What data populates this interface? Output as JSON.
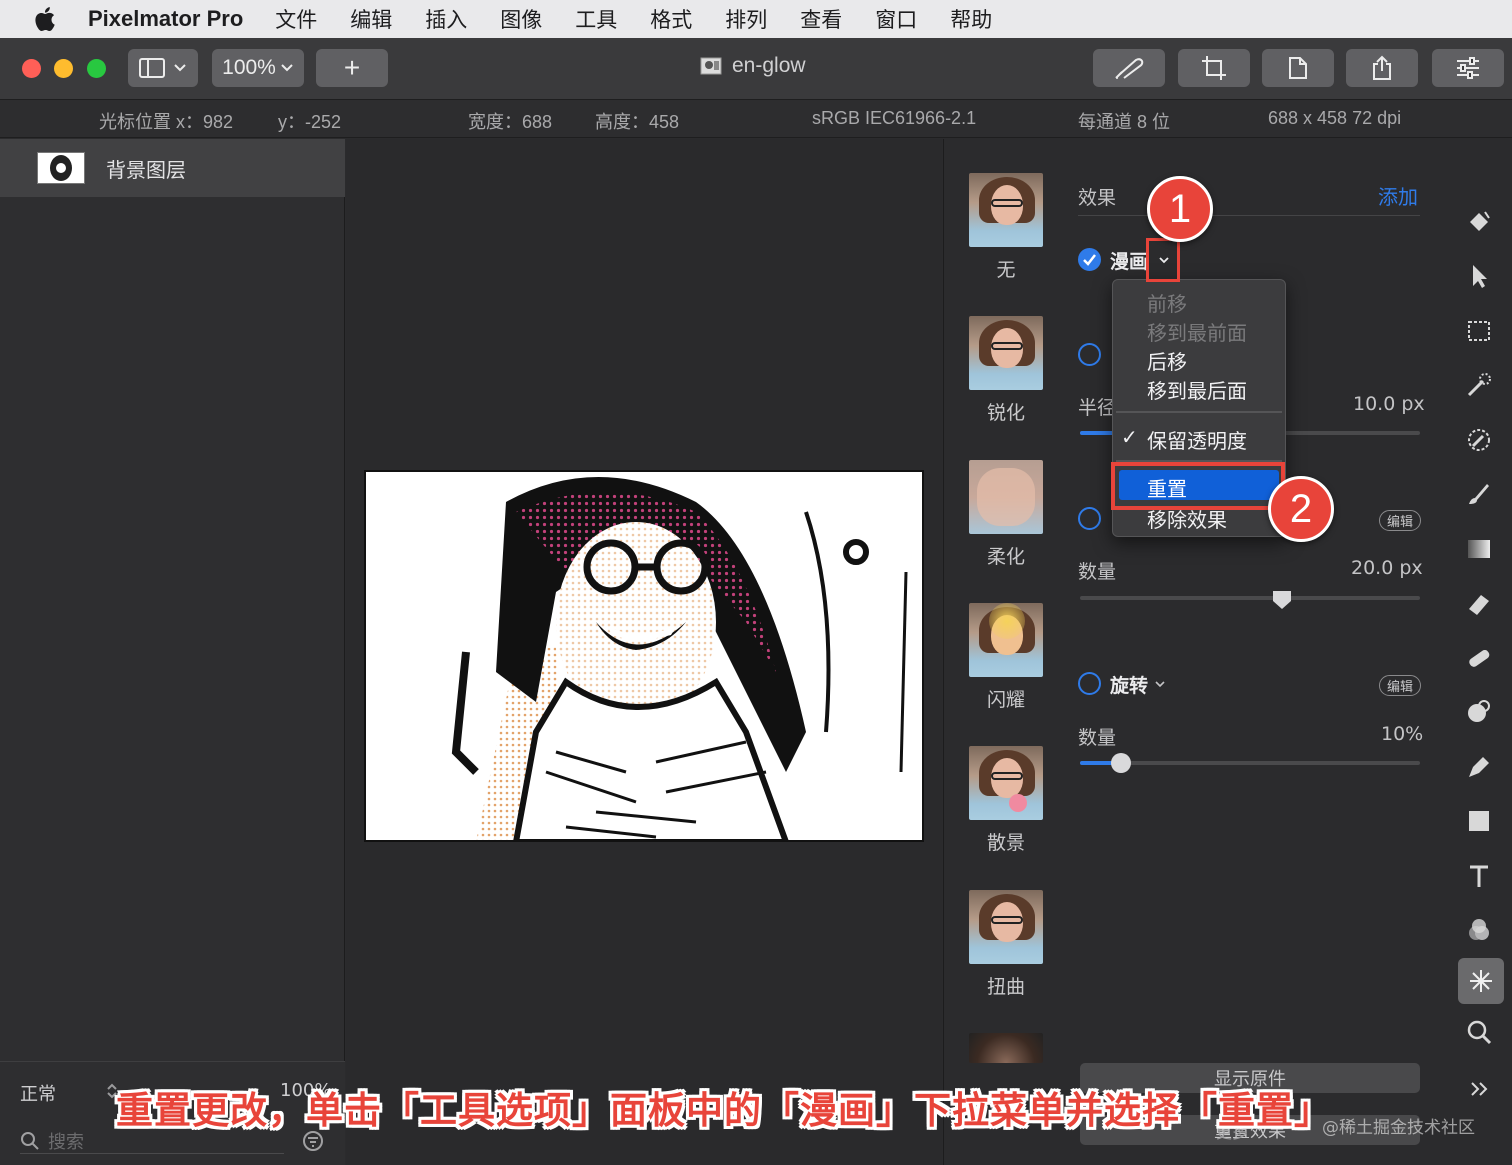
{
  "menubar": {
    "app_name": "Pixelmator Pro",
    "items": [
      "文件",
      "编辑",
      "插入",
      "图像",
      "工具",
      "格式",
      "排列",
      "查看",
      "窗口",
      "帮助"
    ]
  },
  "toolbar": {
    "zoom": "100%",
    "add_label": "+",
    "document_title": "en-glow"
  },
  "infobar": {
    "cursor_x": "光标位置 x：982",
    "cursor_y": "y：-252",
    "width": "宽度：688",
    "height": "高度：458",
    "color_profile": "sRGB IEC61966-2.1",
    "bit_depth": "每通道 8 位",
    "dimensions": "688 x 458 72 dpi"
  },
  "layers": {
    "layer_name": "背景图层",
    "blend_mode": "正常",
    "opacity": "100%",
    "search_placeholder": "搜索"
  },
  "effects_browser": [
    {
      "label": "无"
    },
    {
      "label": "锐化"
    },
    {
      "label": "柔化"
    },
    {
      "label": "闪耀"
    },
    {
      "label": "散景"
    },
    {
      "label": "扭曲"
    }
  ],
  "settings": {
    "section_title": "效果",
    "add_label": "添加",
    "effect1_name": "漫画",
    "radius_label": "半径",
    "radius_value": "10.0 px",
    "edit_label": "编辑",
    "amount_label": "数量",
    "amount_value": "20.0 px",
    "effect3_name": "旋转",
    "amount2_label": "数量",
    "amount2_value": "10%",
    "show_original": "显示原件",
    "reset_effects": "重置效果",
    "more": "更多"
  },
  "dropdown": {
    "items": [
      {
        "label": "前移",
        "enabled": false
      },
      {
        "label": "移到最前面",
        "enabled": false
      },
      {
        "label": "后移",
        "enabled": true
      },
      {
        "label": "移到最后面",
        "enabled": true
      },
      {
        "label": "保留透明度",
        "enabled": true,
        "checked": true
      },
      {
        "label": "重置",
        "enabled": true,
        "highlighted": true
      },
      {
        "label": "移除效果",
        "enabled": true
      }
    ],
    "check_mark": "✓"
  },
  "annotations": {
    "callout1": "1",
    "callout2": "2",
    "caption": "重置更改，单击「工具选项」面板中的「漫画」下拉菜单并选择「重置」",
    "watermark": "@稀土掘金技术社区"
  },
  "tool_icons": [
    "paint-bucket-icon",
    "arrow-select-icon",
    "rect-select-icon",
    "magic-wand-icon",
    "eyedropper-icon",
    "brush-icon",
    "gradient-icon",
    "eraser-icon",
    "bandage-icon",
    "clone-icon",
    "pen-icon",
    "shape-icon",
    "type-icon",
    "color-adjust-icon",
    "effects-icon",
    "zoom-icon"
  ],
  "colors": {
    "accent": "#2f7be9",
    "highlight_box": "#e8443a",
    "menu_highlight": "#1060d8"
  }
}
